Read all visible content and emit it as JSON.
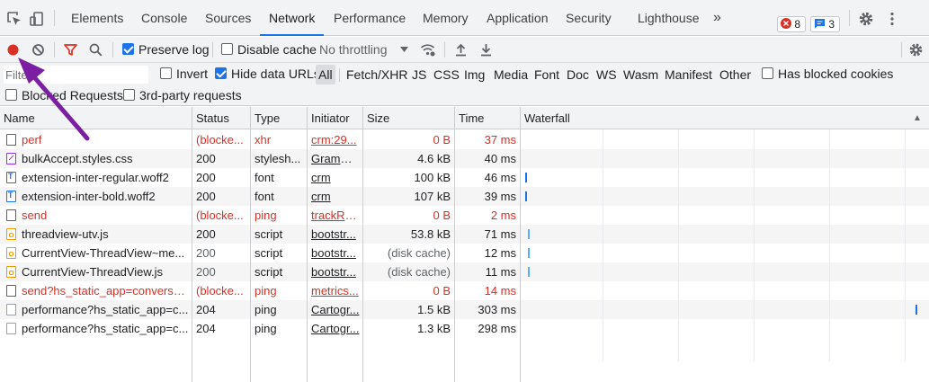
{
  "tabs": [
    {
      "label": "Elements",
      "active": false
    },
    {
      "label": "Console",
      "active": false
    },
    {
      "label": "Sources",
      "active": false
    },
    {
      "label": "Network",
      "active": true
    },
    {
      "label": "Performance",
      "active": false
    },
    {
      "label": "Memory",
      "active": false
    },
    {
      "label": "Application",
      "active": false
    },
    {
      "label": "Security",
      "active": false
    },
    {
      "label": "Lighthouse",
      "active": false
    }
  ],
  "tabbar": {
    "more_tabs_icon": "»",
    "errors_count": "8",
    "messages_count": "3",
    "icons": [
      "inspect-element-icon",
      "device-toggle-icon",
      "settings-gear-icon",
      "kebab-menu-icon",
      "error-circle-icon",
      "message-icon"
    ]
  },
  "toolbar": {
    "preserve_log_label": "Preserve log",
    "preserve_log_checked": true,
    "disable_cache_label": "Disable cache",
    "disable_cache_checked": false,
    "throttling_value": "No throttling",
    "icons": [
      "record-icon",
      "clear-icon",
      "filter-icon",
      "search-icon",
      "network-conditions-icon",
      "import-har-icon",
      "export-har-icon",
      "settings-gear-icon"
    ],
    "record_color": "#d93025"
  },
  "filter": {
    "placeholder": "Filter",
    "value": "",
    "invert_label": "Invert",
    "invert_checked": false,
    "hide_data_urls_label": "Hide data URLs",
    "hide_data_urls_checked": true,
    "types": [
      "All",
      "Fetch/XHR",
      "JS",
      "CSS",
      "Img",
      "Media",
      "Font",
      "Doc",
      "WS",
      "Wasm",
      "Manifest",
      "Other"
    ],
    "active_type": "All",
    "has_blocked_cookies_label": "Has blocked cookies",
    "blocked_requests_label": "Blocked Requests",
    "third_party_label": "3rd-party requests"
  },
  "columns": {
    "name": "Name",
    "status": "Status",
    "type": "Type",
    "initiator": "Initiator",
    "size": "Size",
    "time": "Time",
    "waterfall": "Waterfall",
    "sort_icon": "▲"
  },
  "rows": [
    {
      "name": "perf",
      "status": "(blocke...",
      "type": "xhr",
      "initiator": "crm:29...",
      "size": "0 B",
      "time": "37 ms",
      "state": "err",
      "icon": "red"
    },
    {
      "name": "bulkAccept.styles.css",
      "status": "200",
      "type": "stylesh...",
      "initiator": "Gramm...",
      "size": "4.6 kB",
      "time": "40 ms",
      "state": "normal",
      "icon": "css"
    },
    {
      "name": "extension-inter-regular.woff2",
      "status": "200",
      "type": "font",
      "initiator": "crm",
      "size": "100 kB",
      "time": "46 ms",
      "state": "normal",
      "icon": "font"
    },
    {
      "name": "extension-inter-bold.woff2",
      "status": "200",
      "type": "font",
      "initiator": "crm",
      "size": "107 kB",
      "time": "39 ms",
      "state": "normal",
      "icon": "font"
    },
    {
      "name": "send",
      "status": "(blocke...",
      "type": "ping",
      "initiator": "trackRe...",
      "size": "0 B",
      "time": "2 ms",
      "state": "err",
      "icon": "red"
    },
    {
      "name": "threadview-utv.js",
      "status": "200",
      "type": "script",
      "initiator": "bootstr...",
      "size": "53.8 kB",
      "time": "71 ms",
      "state": "normal",
      "icon": "js"
    },
    {
      "name": "CurrentView-ThreadView~me...",
      "status": "200",
      "type": "script",
      "initiator": "bootstr...",
      "size": "(disk cache)",
      "time": "12 ms",
      "state": "cached",
      "icon": "js"
    },
    {
      "name": "CurrentView-ThreadView.js",
      "status": "200",
      "type": "script",
      "initiator": "bootstr...",
      "size": "(disk cache)",
      "time": "11 ms",
      "state": "cached",
      "icon": "js"
    },
    {
      "name": "send?hs_static_app=conversa...",
      "status": "(blocke...",
      "type": "ping",
      "initiator": "metrics...",
      "size": "0 B",
      "time": "14 ms",
      "state": "err",
      "icon": "red"
    },
    {
      "name": "performance?hs_static_app=c...",
      "status": "204",
      "type": "ping",
      "initiator": "Cartogr...",
      "size": "1.5 kB",
      "time": "303 ms",
      "state": "normal",
      "icon": "plain"
    },
    {
      "name": "performance?hs_static_app=c...",
      "status": "204",
      "type": "ping",
      "initiator": "Cartogr...",
      "size": "1.3 kB",
      "time": "298 ms",
      "state": "normal",
      "icon": "plain"
    }
  ],
  "annotation": {
    "arrow_color": "#7b1fa2"
  }
}
